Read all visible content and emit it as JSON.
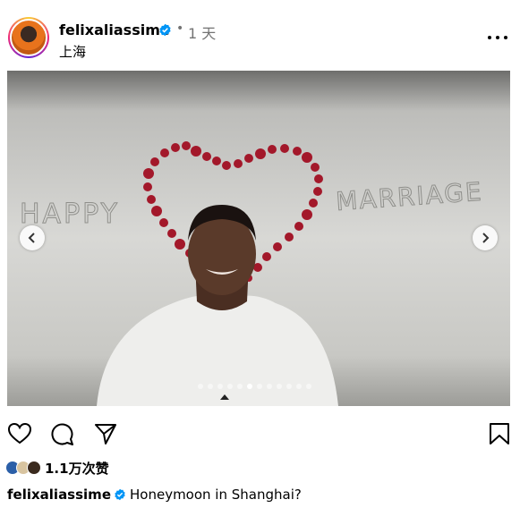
{
  "post": {
    "username": "felixaliassime",
    "separator": "•",
    "time": "1 天",
    "location": "上海",
    "more_icon": "more-horizontal-icon"
  },
  "media": {
    "photo_text_left": "HAPPY",
    "photo_text_right": "MARRIAGE",
    "carousel_count": 12,
    "carousel_active_index": 5,
    "prev_icon": "chevron-left-icon",
    "next_icon": "chevron-right-icon"
  },
  "actions": {
    "like_icon": "heart-icon",
    "comment_icon": "comment-icon",
    "share_icon": "send-icon",
    "save_icon": "bookmark-icon"
  },
  "likes": {
    "text": "1.1万次赞"
  },
  "caption": {
    "username": "felixaliassime",
    "text": "Honeymoon in Shanghai?"
  },
  "colors": {
    "verified": "#0095f6",
    "rose_petals": "#a3182a"
  }
}
